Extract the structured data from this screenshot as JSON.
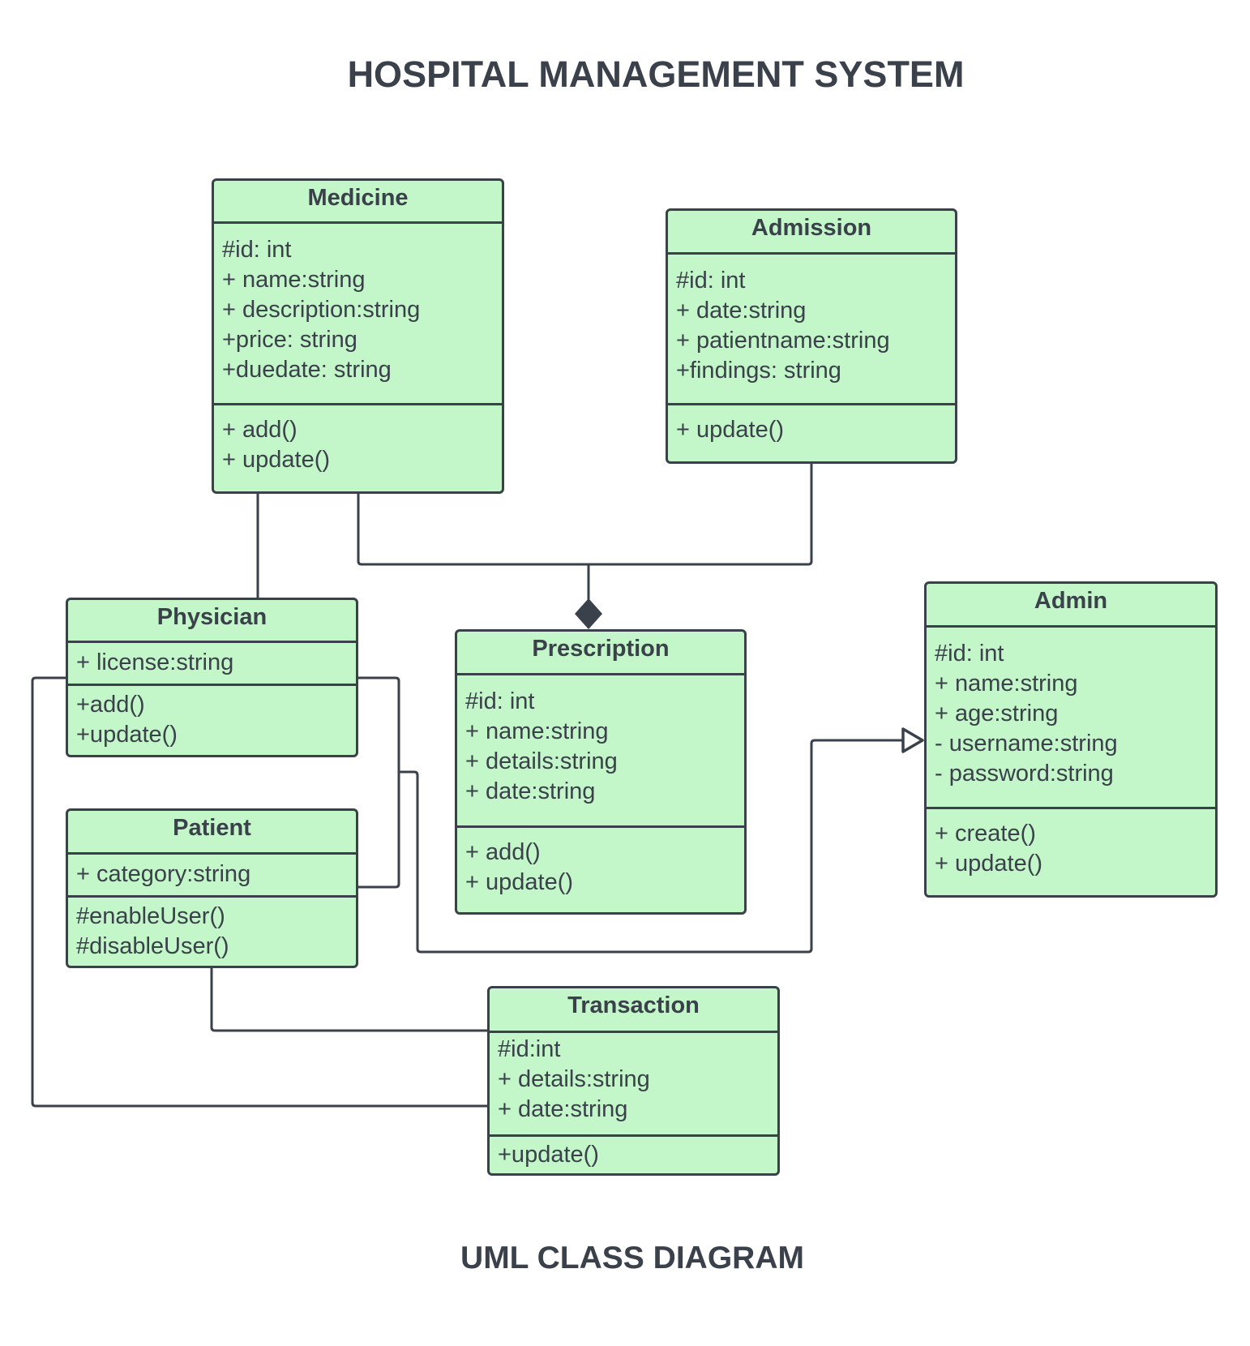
{
  "title": "HOSPITAL MANAGEMENT SYSTEM",
  "caption": "UML CLASS DIAGRAM",
  "colors": {
    "class_fill": "#c3f6c8",
    "stroke": "#3a414a",
    "background": "#ffffff"
  },
  "classes": {
    "medicine": {
      "name": "Medicine",
      "attributes": [
        "#id: int",
        "+ name:string",
        "+ description:string",
        "+price: string",
        "+duedate: string"
      ],
      "methods": [
        "+ add()",
        "+ update()"
      ]
    },
    "admission": {
      "name": "Admission",
      "attributes": [
        "#id: int",
        "+ date:string",
        "+ patientname:string",
        "+findings: string"
      ],
      "methods": [
        "+ update()"
      ]
    },
    "physician": {
      "name": "Physician",
      "attributes": [
        "+ license:string"
      ],
      "methods": [
        "+add()",
        "+update()"
      ]
    },
    "patient": {
      "name": "Patient",
      "attributes": [
        "+ category:string"
      ],
      "methods": [
        "#enableUser()",
        "#disableUser()"
      ]
    },
    "prescription": {
      "name": "Prescription",
      "attributes": [
        "#id: int",
        "+ name:string",
        "+ details:string",
        "+ date:string"
      ],
      "methods": [
        "+ add()",
        "+ update()"
      ]
    },
    "admin": {
      "name": "Admin",
      "attributes": [
        "#id: int",
        "+ name:string",
        "+ age:string",
        "- username:string",
        "- password:string"
      ],
      "methods": [
        "+ create()",
        "+ update()"
      ]
    },
    "transaction": {
      "name": "Transaction",
      "attributes": [
        "#id:int",
        "+ details:string",
        "+ date:string"
      ],
      "methods": [
        "+update()"
      ]
    }
  },
  "relationships": [
    {
      "type": "association",
      "from": "Physician",
      "to": "Medicine"
    },
    {
      "type": "composition",
      "from": "Medicine",
      "to": "Prescription"
    },
    {
      "type": "composition",
      "from": "Admission",
      "to": "Prescription"
    },
    {
      "type": "association",
      "from": "Physician",
      "to": "Patient"
    },
    {
      "type": "generalization",
      "from": "Physician/Patient",
      "to": "Admin"
    },
    {
      "type": "association",
      "from": "Physician",
      "to": "Transaction"
    },
    {
      "type": "association",
      "from": "Patient",
      "to": "Transaction"
    }
  ]
}
